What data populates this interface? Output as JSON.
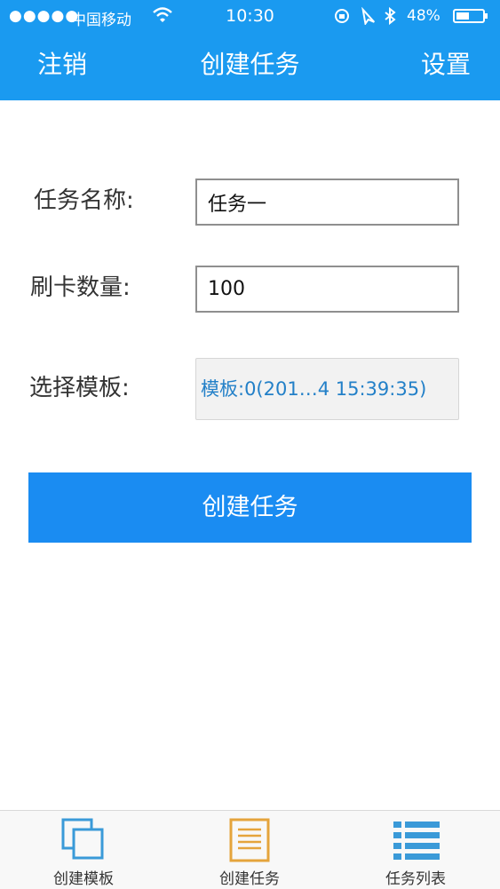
{
  "status_bar": {
    "signal": "●●●●●",
    "carrier": "中国移动",
    "wifi": "wifi-icon",
    "time": "10:30",
    "battery_percent": "48%",
    "right_icons": [
      "lock-rotation-icon",
      "location-icon",
      "bluetooth-icon"
    ]
  },
  "nav": {
    "left_label": "注销",
    "title": "创建任务",
    "right_label": "设置"
  },
  "form": {
    "task_name_label": "任务名称:",
    "task_name_value": "任务一",
    "card_count_label": "刷卡数量:",
    "card_count_value": "100",
    "template_label": "选择模板:",
    "template_value": "模板:0(201…4 15:39:35)",
    "submit_label": "创建任务"
  },
  "tabbar": {
    "items": [
      {
        "label": "创建模板",
        "icon": "copy-icon"
      },
      {
        "label": "创建任务",
        "icon": "document-icon"
      },
      {
        "label": "任务列表",
        "icon": "list-icon"
      }
    ]
  },
  "colors": {
    "header": "#1a9af0",
    "button": "#1a8cf2",
    "template_text": "#2380c8",
    "tab_icon_blue": "#3a9ad8",
    "tab_icon_orange": "#e5a43c"
  }
}
